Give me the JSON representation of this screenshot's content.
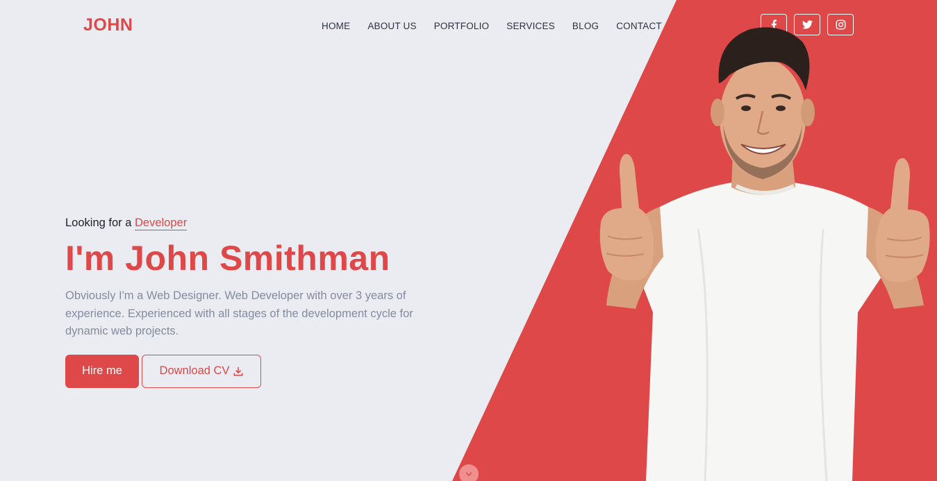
{
  "brand": {
    "logo": "JOHN"
  },
  "nav": {
    "items": [
      {
        "label": "HOME"
      },
      {
        "label": "ABOUT US"
      },
      {
        "label": "PORTFOLIO"
      },
      {
        "label": "SERVICES"
      },
      {
        "label": "BLOG"
      },
      {
        "label": "CONTACT"
      }
    ]
  },
  "social": {
    "icons": [
      "facebook-icon",
      "twitter-icon",
      "instagram-icon"
    ]
  },
  "hero": {
    "kicker_prefix": "Looking for a",
    "kicker_highlight": "Developer",
    "title": "I'm John Smithman",
    "description": "Obviously I'm a Web Designer. Web Developer with over 3 years of experience. Experienced with all stages of the development cycle for dynamic web projects.",
    "hire_label": "Hire me",
    "download_label": "Download CV"
  },
  "colors": {
    "accent": "#de4848",
    "background": "#eaecf1",
    "text_dark": "#2b3142",
    "text_muted": "#838b9f"
  }
}
